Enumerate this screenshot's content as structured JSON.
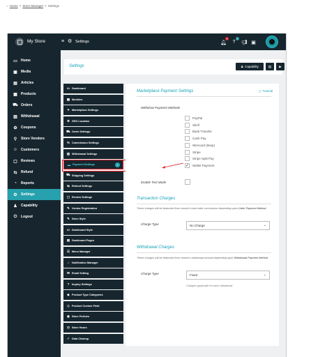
{
  "breadcrumb": {
    "home": "Home",
    "sep1": ">",
    "store_manager": "Store Manager",
    "sep2": ">",
    "current": "Settings"
  },
  "topbar": {
    "store_name": "My Store",
    "section": "Settings",
    "notif_count_1": "5",
    "notif_count_2": "0"
  },
  "sidebar": {
    "items": [
      {
        "label": "Home",
        "icon": "monitor-icon",
        "glyph": "▭"
      },
      {
        "label": "Media",
        "icon": "media-icon",
        "glyph": "▣"
      },
      {
        "label": "Articles",
        "icon": "articles-icon",
        "glyph": "▤"
      },
      {
        "label": "Products",
        "icon": "products-icon",
        "glyph": "▦"
      },
      {
        "label": "Orders",
        "icon": "cart-icon",
        "glyph": "⛟"
      },
      {
        "label": "Withdrawal",
        "icon": "withdrawal-icon",
        "glyph": "▥"
      },
      {
        "label": "Coupons",
        "icon": "coupon-icon",
        "glyph": "✿"
      },
      {
        "label": "Store Vendors",
        "icon": "vendors-icon",
        "glyph": "⚲"
      },
      {
        "label": "Customers",
        "icon": "customers-icon",
        "glyph": "☺"
      },
      {
        "label": "Reviews",
        "icon": "reviews-icon",
        "glyph": "▢"
      },
      {
        "label": "Refund",
        "icon": "refund-icon",
        "glyph": "⇆"
      },
      {
        "label": "Reports",
        "icon": "reports-icon",
        "glyph": "◔"
      },
      {
        "label": "Settings",
        "icon": "gear-icon",
        "glyph": "⚙"
      },
      {
        "label": "Capability",
        "icon": "capability-icon",
        "glyph": "♟"
      },
      {
        "label": "Logout",
        "icon": "power-icon",
        "glyph": "⏻"
      }
    ],
    "active_index": 12
  },
  "header": {
    "title": "Settings",
    "capability_label": "Capability"
  },
  "settings_menu": [
    {
      "label": "Dashboard",
      "glyph": "▭"
    },
    {
      "label": "Modules",
      "glyph": "▦"
    },
    {
      "label": "Marketplace Settings",
      "glyph": "✦"
    },
    {
      "label": "GEO Location",
      "glyph": "✚"
    },
    {
      "label": "Order Settings",
      "glyph": "⛟"
    },
    {
      "label": "Commission Settings",
      "glyph": "%"
    },
    {
      "label": "Withdrawal Settings",
      "glyph": "▥"
    },
    {
      "label": "Payment Settings",
      "glyph": "▬"
    },
    {
      "label": "Shipping Settings",
      "glyph": "⛟"
    },
    {
      "label": "Refund Settings",
      "glyph": "⇆"
    },
    {
      "label": "Review Settings",
      "glyph": "▢"
    },
    {
      "label": "Vendor Registration",
      "glyph": "✎"
    },
    {
      "label": "Store Style",
      "glyph": "✎"
    },
    {
      "label": "Dashboard Style",
      "glyph": "▭"
    },
    {
      "label": "Dashboard Pages",
      "glyph": "▤"
    },
    {
      "label": "Menu Manager",
      "glyph": "☰"
    },
    {
      "label": "Notification Manager",
      "glyph": "♪"
    },
    {
      "label": "Email Setting",
      "glyph": "✉"
    },
    {
      "label": "Inquiry Settings",
      "glyph": "?"
    },
    {
      "label": "Product Type Categories",
      "glyph": "◆"
    },
    {
      "label": "Product Custom Field",
      "glyph": "◇"
    },
    {
      "label": "Store Policies",
      "glyph": "◉"
    },
    {
      "label": "Store Hours",
      "glyph": "◷"
    },
    {
      "label": "Data Cleanup",
      "glyph": "✓"
    }
  ],
  "selected_menu_index": 7,
  "panel": {
    "title": "Marketplace Payment Settings",
    "tutorial": "Tutorial",
    "withdrawal_methods_label": "Withdraw Payment Methods",
    "methods": [
      {
        "label": "PayPal",
        "checked": false
      },
      {
        "label": "Skrill",
        "checked": false
      },
      {
        "label": "Bank Transfer",
        "checked": false
      },
      {
        "label": "Cash Pay",
        "checked": false
      },
      {
        "label": "Wirecard (Moip)",
        "checked": false
      },
      {
        "label": "Stripe",
        "checked": false
      },
      {
        "label": "Stripe Split Pay",
        "checked": false
      },
      {
        "label": "Wallet Payment",
        "checked": true
      }
    ],
    "test_mode_label": "Enable Test Mode",
    "transaction_title": "Transaction Charges",
    "transaction_note_prefix": "These charges will be deducted from vendor's total order commission depending upon ",
    "transaction_note_link": "Order Payment Method",
    "transaction_note_suffix": ".",
    "transaction_charge_type_label": "Charge Type",
    "transaction_charge_type_value": "No Charge",
    "withdrawal_title": "Withdrawal Charges",
    "withdrawal_note_prefix": "These charges will be deducted from vendor's withdrawal amount depending upon ",
    "withdrawal_note_link": "Withdrawal Payment Method",
    "withdrawal_note_suffix": ".",
    "withdrawal_charge_type_label": "Charge Type",
    "withdrawal_charge_type_value": "Fixed",
    "withdrawal_help": "Charges applicable for each withdarwal"
  },
  "colors": {
    "dark": "#17262e",
    "accent": "#26a1ad",
    "highlight": "#e21f26"
  }
}
